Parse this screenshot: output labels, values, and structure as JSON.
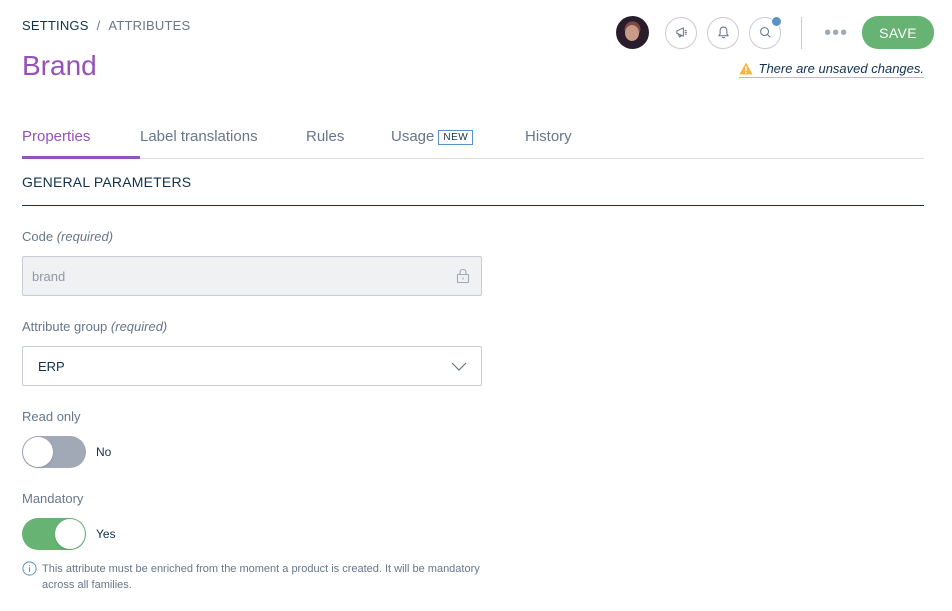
{
  "breadcrumb": {
    "root": "SETTINGS",
    "separator": "/",
    "current": "ATTRIBUTES"
  },
  "title": "Brand",
  "header": {
    "save_label": "SAVE",
    "more_label": "•••",
    "unsaved_message": "There are unsaved changes.",
    "icons": [
      "avatar",
      "megaphone-icon",
      "bell-icon",
      "search-icon",
      "more-icon"
    ]
  },
  "tabs": [
    {
      "label": "Properties",
      "active": true
    },
    {
      "label": "Label translations",
      "active": false
    },
    {
      "label": "Rules",
      "active": false
    },
    {
      "label": "Usage",
      "badge": "NEW",
      "active": false
    },
    {
      "label": "History",
      "active": false
    }
  ],
  "section": {
    "title": "GENERAL PARAMETERS"
  },
  "fields": {
    "code": {
      "label": "Code",
      "qualifier": "(required)",
      "value": "brand",
      "locked": true
    },
    "attribute_group": {
      "label": "Attribute group",
      "qualifier": "(required)",
      "value": "ERP"
    },
    "read_only": {
      "label": "Read only",
      "state": false,
      "value_label": "No"
    },
    "mandatory": {
      "label": "Mandatory",
      "state": true,
      "value_label": "Yes",
      "helper": "This attribute must be enriched from the moment a product is created. It will be mandatory across all families."
    }
  },
  "colors": {
    "accent": "#9452ba",
    "text": "#11324d",
    "muted": "#67768a",
    "save": "#67b373",
    "notification": "#5992c7",
    "warning": "#f9b53f"
  }
}
